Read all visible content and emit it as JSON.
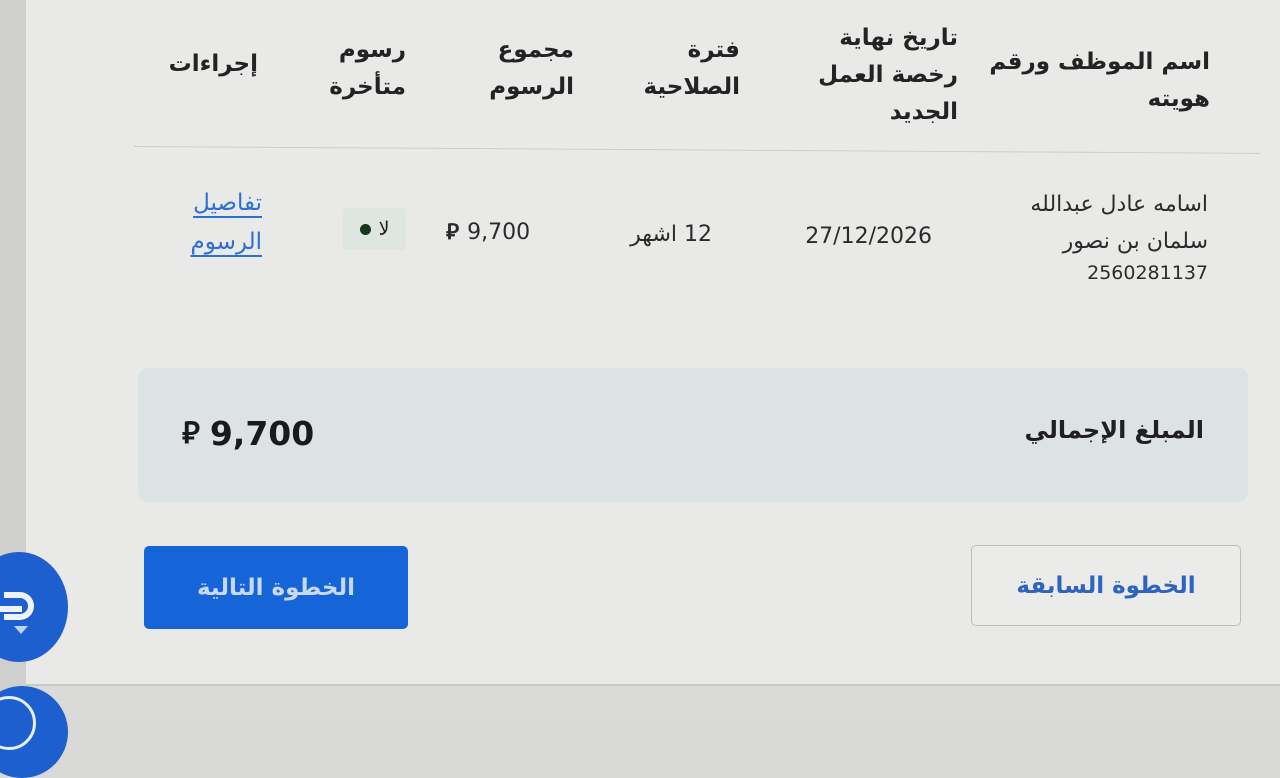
{
  "table": {
    "headers": {
      "employee": [
        "اسم الموظف ورقم",
        "هويته"
      ],
      "license_end_date": [
        "تاريخ نهاية",
        "رخصة العمل",
        "الجديد"
      ],
      "validity_period": [
        "فترة",
        "الصلاحية"
      ],
      "total_fees": [
        "مجموع",
        "الرسوم"
      ],
      "late_fees": [
        "رسوم",
        "متأخرة"
      ],
      "actions": [
        "إجراءات"
      ]
    },
    "rows": [
      {
        "employee_name_line1": "اسامه عادل عبدالله",
        "employee_name_line2": "سلمان بن نصور",
        "employee_id": "2560281137",
        "license_end_date": "27/12/2026",
        "validity_period": "12 اشهر",
        "total_fees": "9,700",
        "late_fees": "لا",
        "action_line1": "تفاصيل",
        "action_line2": "الرسوم"
      }
    ]
  },
  "currency_symbol": "⃁",
  "total": {
    "label": "المبلغ الإجمالي",
    "amount": "9,700"
  },
  "buttons": {
    "next": "الخطوة التالية",
    "previous": "الخطوة السابقة"
  },
  "colors": {
    "primary": "#1565d8",
    "link": "#2c6fd6",
    "badge_bg": "#dfe6e1",
    "badge_dot": "#15361f",
    "total_panel_bg": "#dde3e4"
  },
  "icons": {
    "riyal": "saudi-riyal-icon",
    "fab": "chat-support-icon",
    "fab_secondary": "accessibility-icon"
  }
}
